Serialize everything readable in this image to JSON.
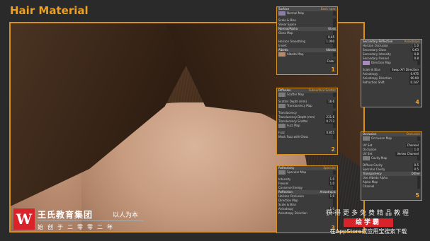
{
  "title": "Hair Material",
  "branding": {
    "logo_letter": "W",
    "name": "王氏教育集团",
    "motto": "以人为本",
    "sub": "始创于二零零二年"
  },
  "promo": {
    "line1": "获得更多免费精品教程",
    "line2": "绘学霸",
    "line3": "在AppStore或应用宝搜索下载"
  },
  "panels": [
    {
      "id": "1",
      "header": "Surface",
      "header_right": "Basic spec",
      "rows": [
        {
          "label": "Normal Map",
          "value": "",
          "thumb": true
        },
        {
          "label": "Scale & Bias",
          "value": ""
        },
        {
          "label": "Shear Space",
          "value": ""
        },
        {
          "label": "Normal/Alpha",
          "value": "Gloss",
          "section": true
        },
        {
          "label": "Gloss Map",
          "value": ""
        },
        {
          "label": "",
          "value": "0.45"
        },
        {
          "label": "Horizon Smoothing",
          "value": "1.000"
        },
        {
          "label": "Invert",
          "value": ""
        },
        {
          "label": "Albedo",
          "value": "Albedo",
          "section": true
        },
        {
          "label": "Albedo Map",
          "value": "",
          "thumb": true
        },
        {
          "label": "",
          "value": "Color"
        }
      ]
    },
    {
      "id": "2",
      "header": "Diffusion",
      "header_right": "Subsurface Scatter",
      "rows": [
        {
          "label": "Scatter Map",
          "value": ""
        },
        {
          "label": "Scatter Depth (mm)",
          "value": "18.6"
        },
        {
          "label": "Translucency Map",
          "value": ""
        },
        {
          "label": "Translucency",
          "value": ""
        },
        {
          "label": "Translucency Depth (mm)",
          "value": "231.6"
        },
        {
          "label": "Translucency Scatter",
          "value": "0.713"
        },
        {
          "label": "Fuzz Map",
          "value": ""
        },
        {
          "label": "Fuzz",
          "value": "0.855"
        },
        {
          "label": "Mask Fuzz with Gloss",
          "value": ""
        }
      ]
    },
    {
      "id": "3",
      "header": "Reflectivity",
      "header_right": "Specular",
      "rows": [
        {
          "label": "Specular Map",
          "value": ""
        },
        {
          "label": "Intensity",
          "value": "1.0"
        },
        {
          "label": "Fresnel",
          "value": "1.0"
        },
        {
          "label": "Conserve Energy",
          "value": ""
        },
        {
          "label": "Reflection",
          "value": "Anisotropic",
          "section": true
        },
        {
          "label": "Horizon Occlusion",
          "value": "1.0"
        },
        {
          "label": "Direction Map",
          "value": ""
        },
        {
          "label": "Scale & Bias",
          "value": ""
        },
        {
          "label": "Anisotropy",
          "value": "1.0"
        },
        {
          "label": "Anisotropy Direction",
          "value": "90"
        }
      ]
    },
    {
      "id": "4",
      "header": "Secondary Reflection",
      "header_right": "Anisotropic",
      "rows": [
        {
          "label": "Horizon Occlusion",
          "value": "1.0"
        },
        {
          "label": "Secondary Gloss",
          "value": "0.63"
        },
        {
          "label": "Secondary Intensity",
          "value": "0.8"
        },
        {
          "label": "Secondary Fresnel",
          "value": "0.8"
        },
        {
          "label": "Direction Map",
          "value": ""
        },
        {
          "label": "Scale & Bias",
          "value": "Swap X/Y Direction"
        },
        {
          "label": "Anisotropy",
          "value": "0.975"
        },
        {
          "label": "Anisotropy Direction",
          "value": "90.00"
        },
        {
          "label": "Refraction Shift",
          "value": "0.247"
        }
      ]
    },
    {
      "id": "5",
      "header": "Occlusion",
      "header_right": "Occlusion",
      "rows": [
        {
          "label": "Occlusion Map",
          "value": ""
        },
        {
          "label": "UV Set",
          "value": "Channel"
        },
        {
          "label": "Occlusion",
          "value": "1.0"
        },
        {
          "label": "UV Set",
          "value": "Vertex Channel"
        },
        {
          "label": "Cavity Map",
          "value": ""
        },
        {
          "label": "Diffuse Cavity",
          "value": "0.5"
        },
        {
          "label": "Specular Cavity",
          "value": "0.5"
        },
        {
          "label": "Transparency",
          "value": "Dither",
          "section": true
        },
        {
          "label": "Use Albedo Alpha",
          "value": ""
        },
        {
          "label": "Alpha Map",
          "value": ""
        },
        {
          "label": "Channel",
          "value": ""
        }
      ]
    }
  ]
}
